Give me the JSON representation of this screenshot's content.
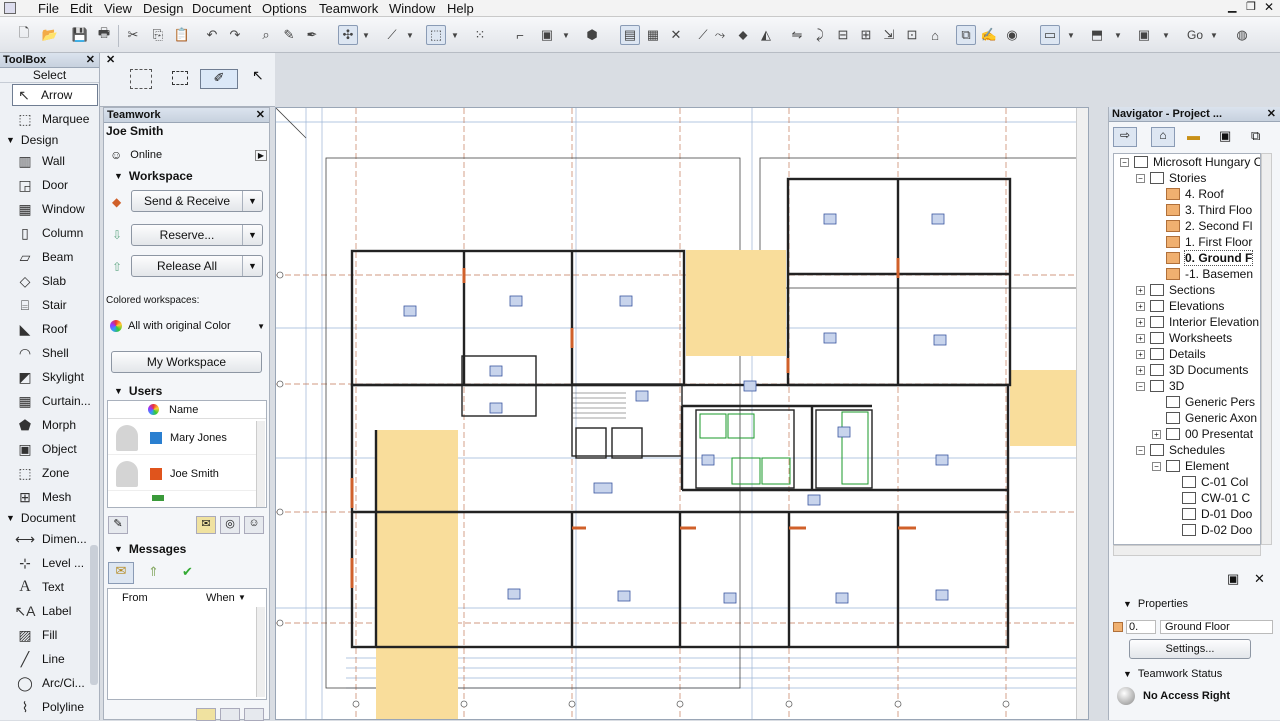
{
  "menu": [
    "File",
    "Edit",
    "View",
    "Design",
    "Document",
    "Options",
    "Teamwork",
    "Window",
    "Help"
  ],
  "toolbar": {
    "go_label": "Go"
  },
  "toolbox": {
    "title": "ToolBox",
    "select_label": "Select",
    "select_tools": [
      "Arrow",
      "Marquee"
    ],
    "design_label": "Design",
    "design_tools": [
      "Wall",
      "Door",
      "Window",
      "Column",
      "Beam",
      "Slab",
      "Stair",
      "Roof",
      "Shell",
      "Skylight",
      "Curtain...",
      "Morph",
      "Object",
      "Zone",
      "Mesh"
    ],
    "document_label": "Document",
    "document_tools": [
      "Dimen...",
      "Level ...",
      "Text",
      "Label",
      "Fill",
      "Line",
      "Arc/Ci...",
      "Polyline"
    ]
  },
  "teamwork": {
    "title": "Teamwork",
    "user": "Joe Smith",
    "status": "Online",
    "workspace_label": "Workspace",
    "send_receive": "Send & Receive",
    "reserve": "Reserve...",
    "release_all": "Release All",
    "colored_label": "Colored workspaces:",
    "colored_value": "All with original Color",
    "my_workspace": "My Workspace",
    "users_label": "Users",
    "users_header": "Name",
    "users": [
      {
        "name": "Mary Jones",
        "color": "#2a7fd0"
      },
      {
        "name": "Joe Smith",
        "color": "#e0541c"
      }
    ],
    "messages_label": "Messages",
    "msg_from": "From",
    "msg_when": "When"
  },
  "navigator": {
    "title": "Navigator - Project ...",
    "tree": [
      {
        "label": "Microsoft Hungary O",
        "level": 0,
        "kind": "project",
        "pm": "−"
      },
      {
        "label": "Stories",
        "level": 1,
        "kind": "folder",
        "pm": "−"
      },
      {
        "label": "4. Roof",
        "level": 2,
        "kind": "story"
      },
      {
        "label": "3. Third Floo",
        "level": 2,
        "kind": "story"
      },
      {
        "label": "2. Second Fl",
        "level": 2,
        "kind": "story"
      },
      {
        "label": "1. First Floor",
        "level": 2,
        "kind": "story"
      },
      {
        "label": "0. Ground F",
        "level": 2,
        "kind": "story",
        "selected": true
      },
      {
        "label": "-1. Basemen",
        "level": 2,
        "kind": "story"
      },
      {
        "label": "Sections",
        "level": 1,
        "kind": "folder",
        "pm": "+"
      },
      {
        "label": "Elevations",
        "level": 1,
        "kind": "folder",
        "pm": "+"
      },
      {
        "label": "Interior Elevation",
        "level": 1,
        "kind": "folder",
        "pm": "+"
      },
      {
        "label": "Worksheets",
        "level": 1,
        "kind": "folder",
        "pm": "+"
      },
      {
        "label": "Details",
        "level": 1,
        "kind": "folder",
        "pm": "+"
      },
      {
        "label": "3D Documents",
        "level": 1,
        "kind": "folder",
        "pm": "+"
      },
      {
        "label": "3D",
        "level": 1,
        "kind": "folder",
        "pm": "−"
      },
      {
        "label": "Generic Pers",
        "level": 2,
        "kind": "view"
      },
      {
        "label": "Generic Axon",
        "level": 2,
        "kind": "view"
      },
      {
        "label": "00 Presentat",
        "level": 2,
        "kind": "view",
        "pm": "+"
      },
      {
        "label": "Schedules",
        "level": 1,
        "kind": "folder",
        "pm": "−"
      },
      {
        "label": "Element",
        "level": 2,
        "kind": "folder",
        "pm": "−"
      },
      {
        "label": "C-01 Col",
        "level": 3,
        "kind": "sched"
      },
      {
        "label": "CW-01 C",
        "level": 3,
        "kind": "sched"
      },
      {
        "label": "D-01 Doo",
        "level": 3,
        "kind": "sched"
      },
      {
        "label": "D-02 Doo",
        "level": 3,
        "kind": "sched"
      }
    ],
    "properties_label": "Properties",
    "prop_id": "0.",
    "prop_name": "Ground Floor",
    "settings_label": "Settings...",
    "status_label": "Teamwork Status",
    "access_label": "No Access Right"
  }
}
